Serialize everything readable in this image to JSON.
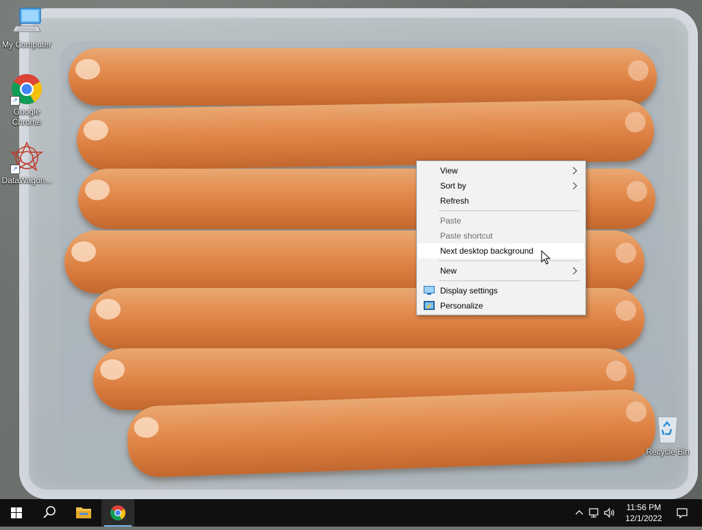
{
  "desktop": {
    "icons": [
      {
        "label": "My Computer"
      },
      {
        "label": "Google Chrome"
      },
      {
        "label": "DataWagon..."
      },
      {
        "label": "Recycle Bin"
      }
    ]
  },
  "context_menu": {
    "items": [
      {
        "label": "View",
        "submenu": true,
        "enabled": true
      },
      {
        "label": "Sort by",
        "submenu": true,
        "enabled": true
      },
      {
        "label": "Refresh",
        "enabled": true
      },
      {
        "label": "Paste",
        "enabled": false
      },
      {
        "label": "Paste shortcut",
        "enabled": false
      },
      {
        "label": "Next desktop background",
        "enabled": true,
        "highlighted": true
      },
      {
        "label": "New",
        "submenu": true,
        "enabled": true
      },
      {
        "label": "Display settings",
        "icon": "display-icon",
        "enabled": true
      },
      {
        "label": "Personalize",
        "icon": "personalize-icon",
        "enabled": true
      }
    ]
  },
  "taskbar": {
    "start_icon": "windows-logo-icon",
    "search_icon": "search-icon",
    "pinned": [
      {
        "name": "File Explorer",
        "icon": "folder-icon"
      },
      {
        "name": "Google Chrome",
        "icon": "chrome-icon",
        "running": true
      }
    ],
    "tray": {
      "icons": [
        "chevron-up-icon",
        "network-icon",
        "volume-icon"
      ],
      "time": "11:56 PM",
      "date": "12/1/2022",
      "notification_icon": "notification-icon"
    }
  },
  "colors": {
    "taskbar_bg": "#101010",
    "menu_bg": "#f2f2f2",
    "accent": "#76b9ed"
  }
}
